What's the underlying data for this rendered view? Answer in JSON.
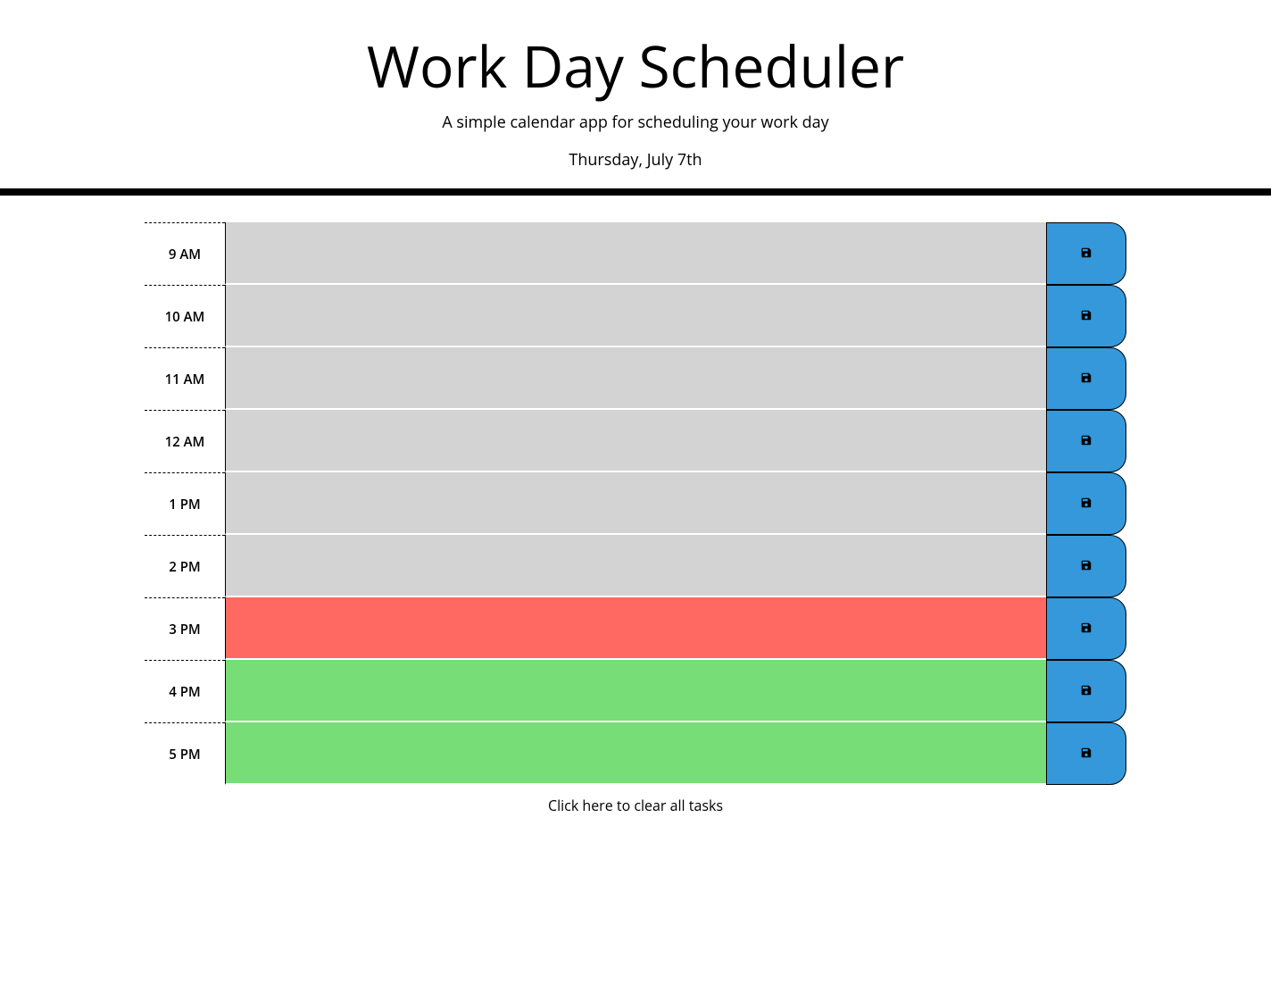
{
  "header": {
    "title": "Work Day Scheduler",
    "subtitle": "A simple calendar app for scheduling your work day",
    "date": "Thursday, July 7th"
  },
  "hours": [
    {
      "label": "9 AM",
      "state": "past",
      "value": ""
    },
    {
      "label": "10 AM",
      "state": "past",
      "value": ""
    },
    {
      "label": "11 AM",
      "state": "past",
      "value": ""
    },
    {
      "label": "12 AM",
      "state": "past",
      "value": ""
    },
    {
      "label": "1 PM",
      "state": "past",
      "value": ""
    },
    {
      "label": "2 PM",
      "state": "past",
      "value": ""
    },
    {
      "label": "3 PM",
      "state": "present",
      "value": ""
    },
    {
      "label": "4 PM",
      "state": "future",
      "value": ""
    },
    {
      "label": "5 PM",
      "state": "future",
      "value": ""
    }
  ],
  "clear_button_label": "Click here to clear all tasks",
  "icons": {
    "save": "save-icon"
  },
  "colors": {
    "past": "#d3d3d3",
    "present": "#ff6961",
    "future": "#77dd77",
    "save_button": "#3498db"
  }
}
